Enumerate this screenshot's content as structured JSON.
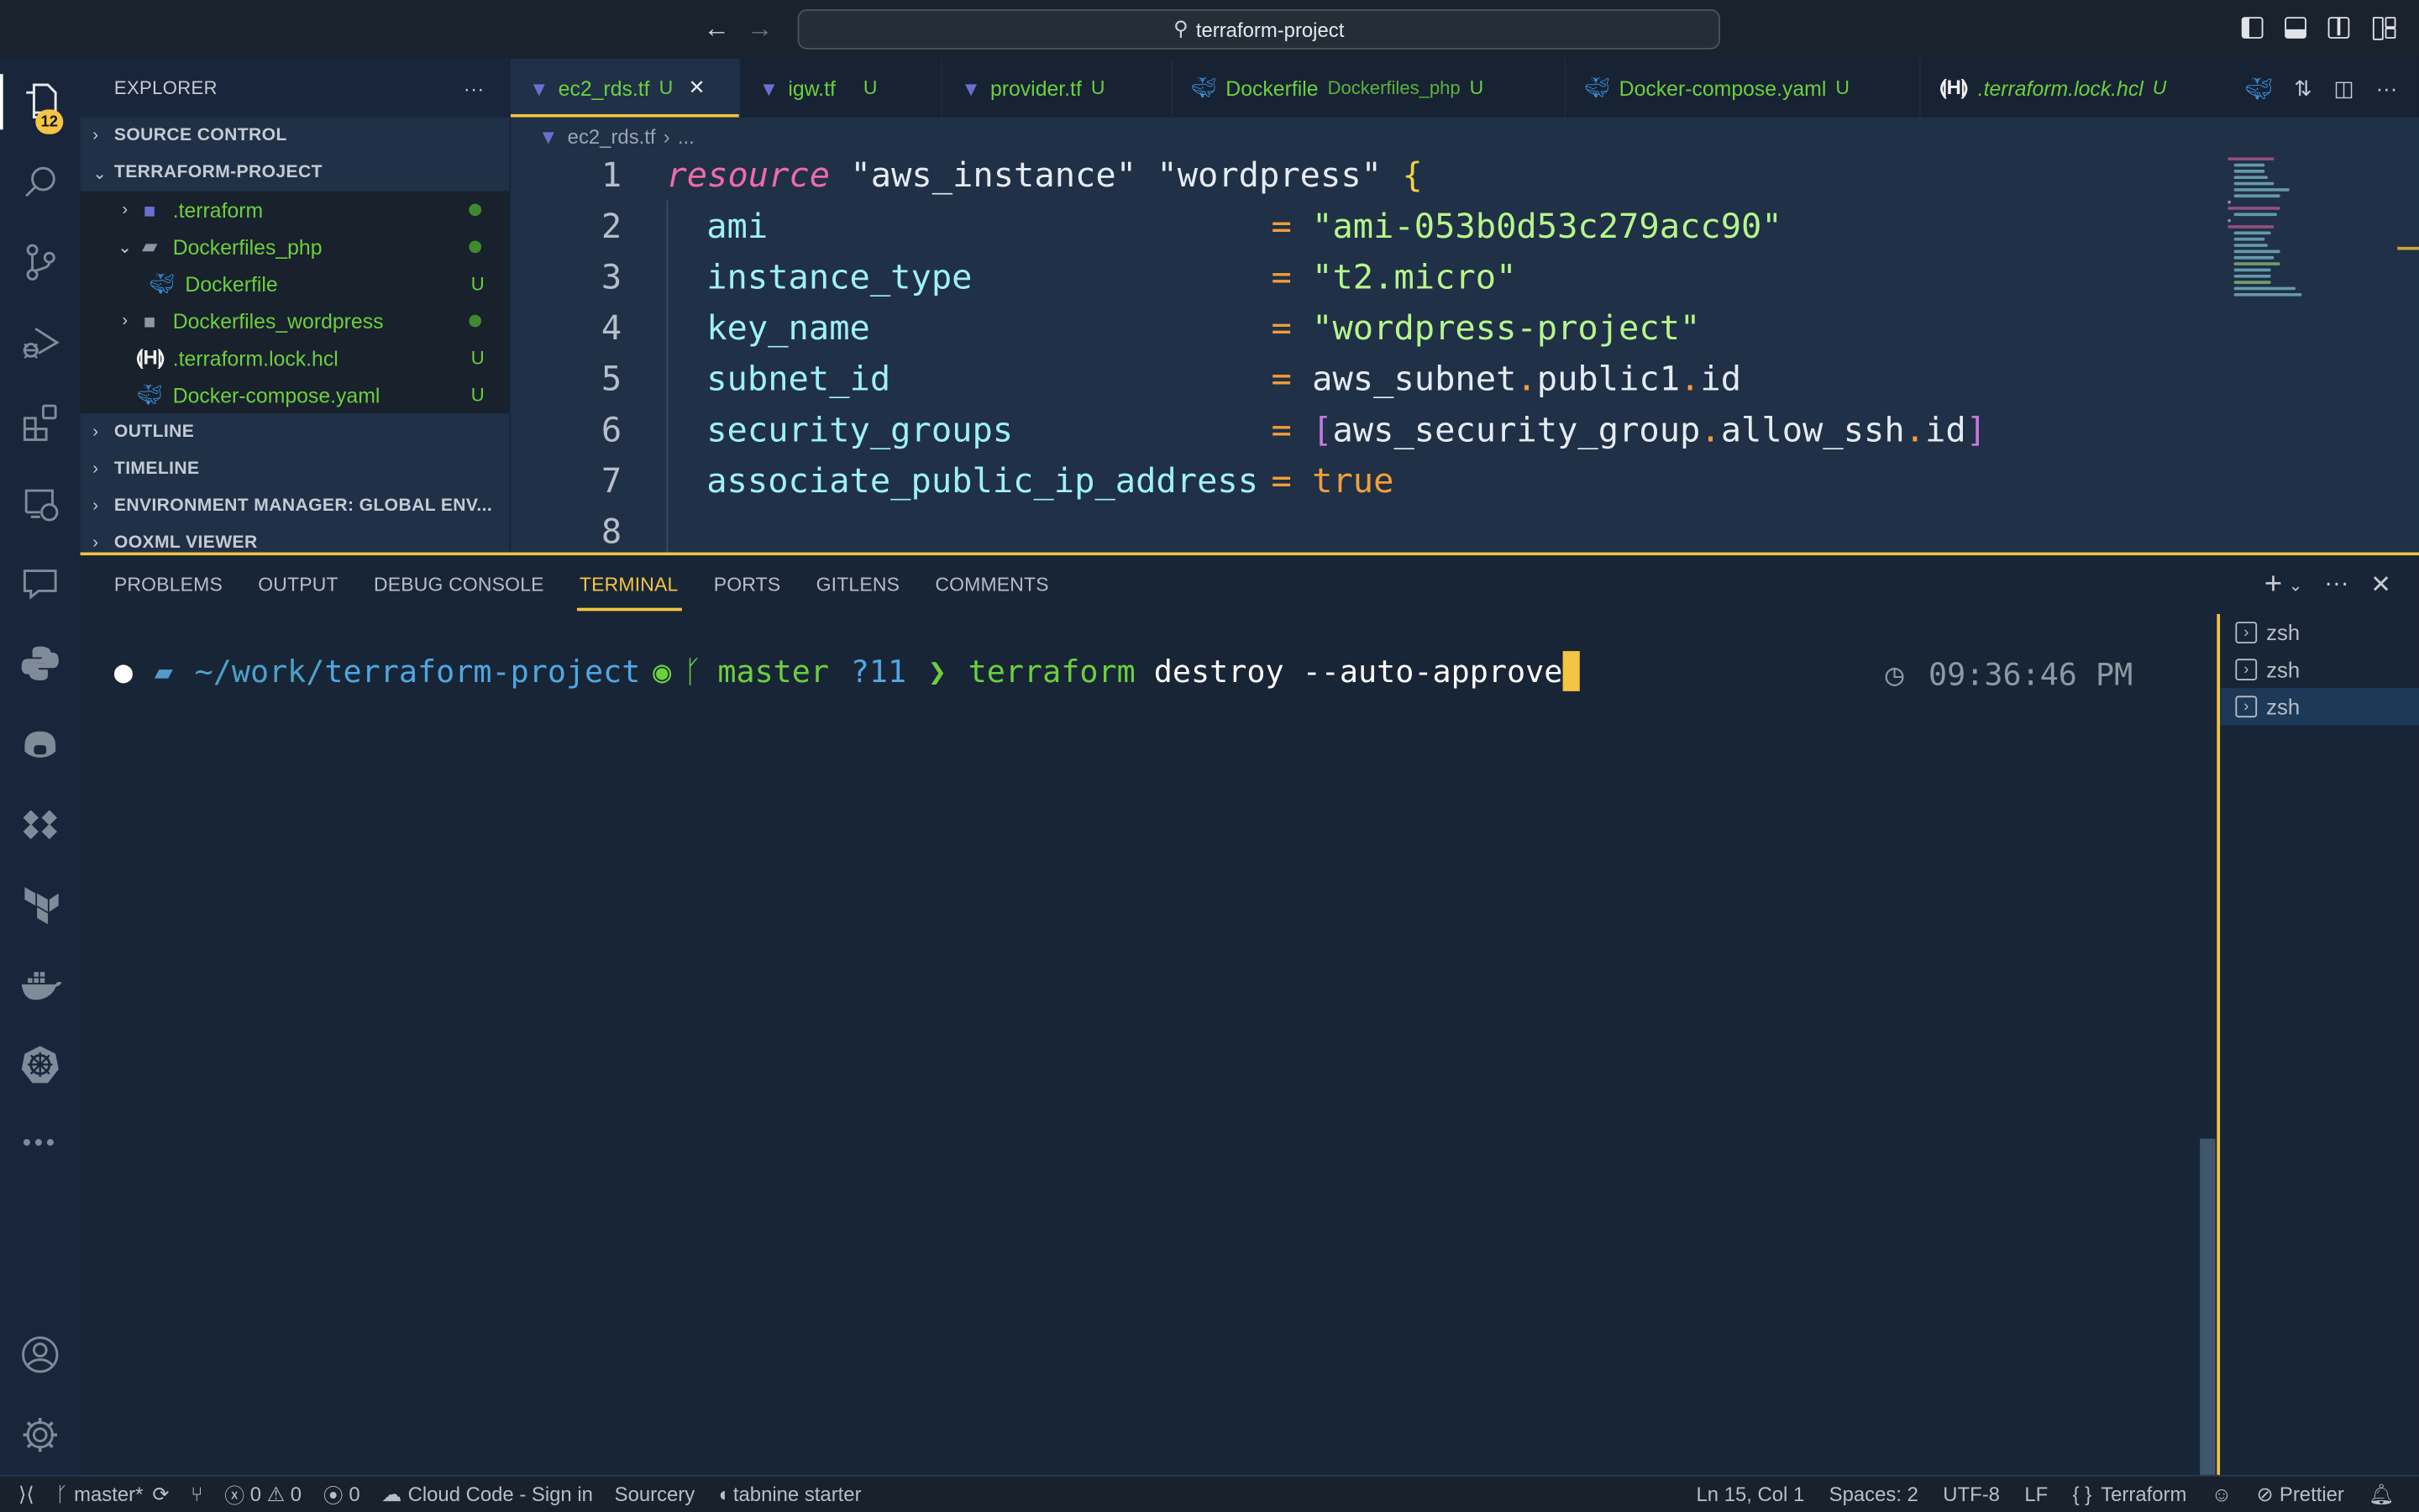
{
  "titlebar": {
    "command_center": "terraform-project",
    "nav_back_icon": "arrow-left",
    "nav_forward_icon": "arrow-right",
    "layout_buttons": [
      "toggle-primary-sidebar",
      "toggle-panel",
      "toggle-secondary-sidebar",
      "customize-layout"
    ]
  },
  "activity_bar": {
    "explorer_badge": "12",
    "items": [
      "explorer",
      "search",
      "source-control",
      "run-and-debug",
      "extensions",
      "remote-explorer",
      "chat",
      "python",
      "copilot",
      "bloc",
      "terraform",
      "docker",
      "kubernetes",
      "more"
    ],
    "bottom": [
      "accounts",
      "manage"
    ]
  },
  "sidebar": {
    "title": "EXPLORER",
    "more": "···",
    "sections": {
      "source_control": "SOURCE CONTROL",
      "project": "TERRAFORM-PROJECT",
      "outline": "OUTLINE",
      "timeline": "TIMELINE",
      "env_manager": "ENVIRONMENT MANAGER: GLOBAL ENV...",
      "ooxml": "OOXML VIEWER"
    },
    "tree": [
      {
        "name": ".terraform",
        "type": "folder",
        "expanded": false,
        "status": "dot"
      },
      {
        "name": "Dockerfiles_php",
        "type": "folder",
        "expanded": true,
        "status": "dot"
      },
      {
        "name": "Dockerfile",
        "type": "docker",
        "status": "U"
      },
      {
        "name": "Dockerfiles_wordpress",
        "type": "folder",
        "expanded": false,
        "status": "dot"
      },
      {
        "name": ".terraform.lock.hcl",
        "type": "hcl",
        "status": "U"
      },
      {
        "name": "Docker-compose.yaml",
        "type": "docker",
        "status": "U"
      }
    ]
  },
  "tabs": [
    {
      "label": "ec2_rds.tf",
      "status": "U",
      "icon": "terraform",
      "active": true
    },
    {
      "label": "igw.tf",
      "status": "U",
      "icon": "terraform"
    },
    {
      "label": "provider.tf",
      "status": "U",
      "icon": "terraform"
    },
    {
      "label": "Dockerfile",
      "desc": "Dockerfiles_php",
      "status": "U",
      "icon": "docker"
    },
    {
      "label": "Docker-compose.yaml",
      "status": "U",
      "icon": "docker"
    },
    {
      "label": ".terraform.lock.hcl",
      "status": "U",
      "icon": "hcl"
    }
  ],
  "breadcrumb": {
    "file": "ec2_rds.tf",
    "rest": "..."
  },
  "editor": {
    "line_numbers": [
      "1",
      "2",
      "3",
      "4",
      "5",
      "6",
      "7",
      "8"
    ],
    "lines": [
      {
        "kw": "resource",
        "s1": "\"aws_instance\"",
        "s2": "\"wordpress\"",
        "brace": "{"
      },
      {
        "attr": "ami",
        "value": "\"ami-053b0d53c279acc90\""
      },
      {
        "attr": "instance_type",
        "value": "\"t2.micro\""
      },
      {
        "attr": "key_name",
        "value": "\"wordpress-project\""
      },
      {
        "attr": "subnet_id",
        "ref": [
          "aws_subnet",
          "public1",
          "id"
        ]
      },
      {
        "attr": "security_groups",
        "ref": [
          "aws_security_group",
          "allow_ssh",
          "id"
        ]
      },
      {
        "attr": "associate_public_ip_address",
        "value": "true"
      }
    ]
  },
  "panel": {
    "tabs": [
      "PROBLEMS",
      "OUTPUT",
      "DEBUG CONSOLE",
      "TERMINAL",
      "PORTS",
      "GITLENS",
      "COMMENTS"
    ],
    "active_tab": "TERMINAL",
    "terminal": {
      "path_prefix": "~/work/",
      "path_dir": "terraform-project",
      "branch": "master",
      "untracked": "?11",
      "command": "terraform",
      "args": "destroy --auto-approve",
      "time": "09:36:46 PM"
    },
    "terminal_list": [
      "zsh",
      "zsh",
      "zsh"
    ],
    "active_terminal_index": 2
  },
  "statusbar": {
    "branch": "master*",
    "errors": "0",
    "warnings": "0",
    "ports": "0",
    "cloud_code": "Cloud Code - Sign in",
    "sourcery": "Sourcery",
    "tabnine": "tabnine starter",
    "position": "Ln 15, Col 1",
    "spaces": "Spaces: 2",
    "encoding": "UTF-8",
    "eol": "LF",
    "language": "Terraform",
    "prettier": "Prettier"
  },
  "colors": {
    "accent": "#f4c542",
    "git_untracked": "#6ccf3e",
    "terraform_icon": "#6b6ed1",
    "docker_icon": "#3b8fd8"
  }
}
